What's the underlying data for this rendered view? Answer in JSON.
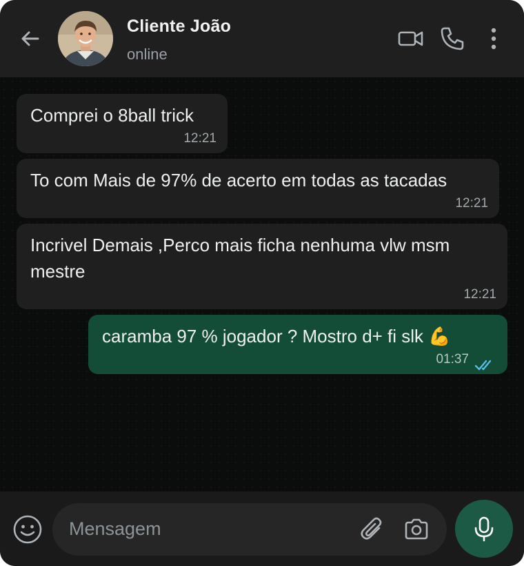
{
  "header": {
    "contact_name": "Cliente João",
    "status": "online",
    "icons": [
      "back-arrow-icon",
      "video-call-icon",
      "phone-icon",
      "more-vert-icon"
    ]
  },
  "messages": [
    {
      "direction": "incoming",
      "text": "Comprei o 8ball trick",
      "time": "12:21"
    },
    {
      "direction": "incoming",
      "text": "To com Mais de 97% de acerto em todas as tacadas",
      "time": "12:21"
    },
    {
      "direction": "incoming",
      "text_lines": [
        "Incrivel Demais ,Perco mais ficha nenhuma vlw msm",
        "mestre"
      ],
      "time": "12:21"
    },
    {
      "direction": "outgoing",
      "text": "caramba 97 % jogador ? Mostro d+ fi slk 💪",
      "time": "01:37",
      "read": true
    }
  ],
  "composer": {
    "placeholder": "Mensagem",
    "icons": [
      "emoji-icon",
      "paperclip-icon",
      "camera-icon",
      "microphone-icon"
    ]
  },
  "colors": {
    "header_bg": "#1f1f1f",
    "incoming_bubble": "#1f1f1f",
    "outgoing_bubble": "#134d37",
    "read_ticks": "#53bdeb",
    "mic_button": "#1d5a45"
  }
}
